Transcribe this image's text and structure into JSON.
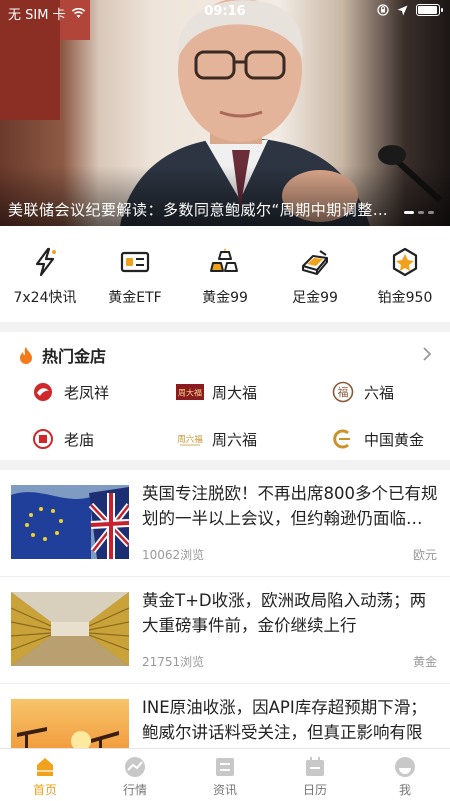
{
  "status_bar": {
    "carrier": "无 SIM 卡",
    "time": "09:16",
    "battery_level": 0.85
  },
  "banner": {
    "caption": "美联储会议纪要解读：多数同意鲍威尔“周期中期调整”说法",
    "slide_count": 3,
    "active_slide": 0
  },
  "quick_links": [
    {
      "label": "7x24快讯",
      "icon": "lightning-icon"
    },
    {
      "label": "黄金ETF",
      "icon": "etf-card-icon"
    },
    {
      "label": "黄金99",
      "icon": "gold-stack-icon"
    },
    {
      "label": "足金99",
      "icon": "gold-bar-icon"
    },
    {
      "label": "铂金950",
      "icon": "platinum-hexagon-icon"
    }
  ],
  "hot_stores": {
    "title": "热门金店",
    "stores": [
      {
        "name": "老凤祥",
        "icon": "laofengxiang-logo"
      },
      {
        "name": "周大福",
        "icon": "zhoudafu-logo",
        "logo_text": "周大福"
      },
      {
        "name": "六福",
        "icon": "liufu-logo",
        "logo_text": "福"
      },
      {
        "name": "老庙",
        "icon": "laomiao-logo"
      },
      {
        "name": "周六福",
        "icon": "zhouliufu-logo",
        "logo_text": "周六福"
      },
      {
        "name": "中国黄金",
        "icon": "china-gold-logo"
      }
    ]
  },
  "news": [
    {
      "headline": "英国专注脱欧！不再出席800多个已有规划的一半以上会议，但约翰逊仍面临压力",
      "views": "10062浏览",
      "tag": "欧元",
      "thumb": "eu-uk-flags"
    },
    {
      "headline": "黄金T+D收涨，欧洲政局陷入动荡；两大重磅事件前，金价继续上行",
      "views": "21751浏览",
      "tag": "黄金",
      "thumb": "gold-bars-vault"
    },
    {
      "headline": "INE原油收涨，因API库存超预期下滑；鲍威尔讲话料受关注，但真正影响有限",
      "views": "",
      "tag": "",
      "thumb": "oil-pumps-sunset"
    }
  ],
  "tabs": [
    {
      "label": "首页",
      "icon": "home-icon",
      "active": true
    },
    {
      "label": "行情",
      "icon": "market-chart-icon",
      "active": false
    },
    {
      "label": "资讯",
      "icon": "news-icon",
      "active": false
    },
    {
      "label": "日历",
      "icon": "calendar-icon",
      "active": false
    },
    {
      "label": "我",
      "icon": "profile-icon",
      "active": false
    }
  ],
  "colors": {
    "accent": "#f0a21c",
    "flame": "#f57a1a",
    "icon_dark": "#222222",
    "tab_inactive": "#c8c8c8"
  }
}
